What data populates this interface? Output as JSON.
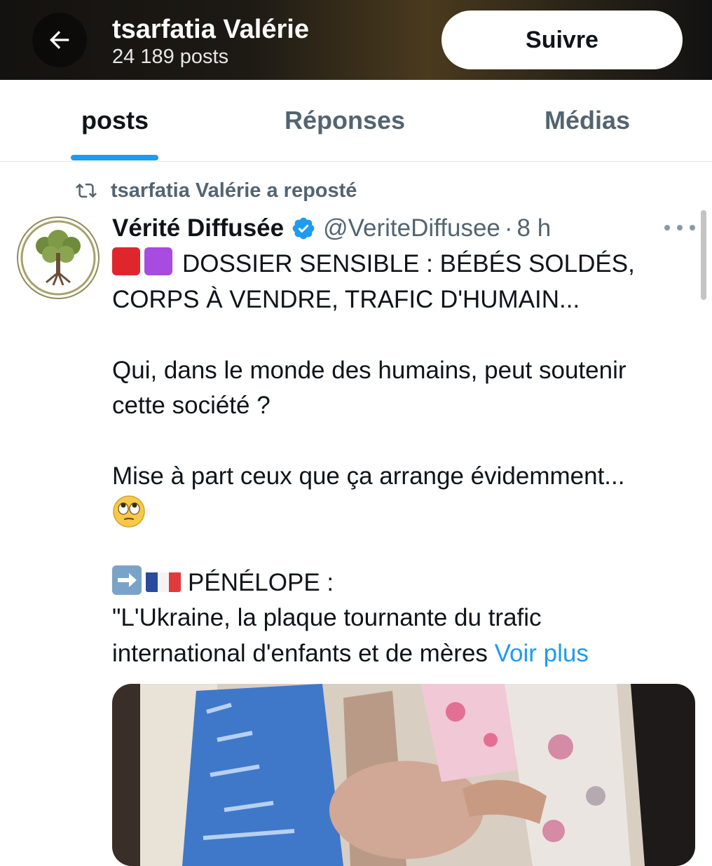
{
  "header": {
    "title": "tsarfatia Valérie",
    "post_count": "24 189 posts",
    "follow_label": "Suivre",
    "back_icon": "arrow-left-icon"
  },
  "tabs": [
    {
      "label": "posts",
      "active": true
    },
    {
      "label": "Réponses",
      "active": false
    },
    {
      "label": "Médias",
      "active": false
    }
  ],
  "repost": {
    "text": "tsarfatia Valérie a reposté",
    "icon": "repost-icon"
  },
  "post": {
    "author": "Vérité Diffusée",
    "verified": true,
    "handle": "@VeriteDiffusee",
    "separator": "·",
    "time": "8 h",
    "more_icon": "ellipsis-icon",
    "lines": {
      "l1": "DOSSIER SENSIBLE : BÉBÉS SOLDÉS,",
      "l2": "CORPS À VENDRE, TRAFIC D'HUMAIN...",
      "l3": "Qui, dans le monde des humains, peut soutenir",
      "l4": "cette société ?",
      "l5": "Mise à part ceux que ça arrange évidemment...",
      "l6": "PÉNÉLOPE :",
      "l7": "\"L'Ukraine, la plaque tournante du trafic",
      "l8": "international d'enfants et de mères"
    },
    "show_more": "Voir plus",
    "emojis": [
      "red-square",
      "purple-square",
      "face-with-rolling-eyes",
      "right-arrow",
      "france-flag"
    ]
  },
  "colors": {
    "accent": "#1d9bf0",
    "secondary_text": "#536471",
    "primary_text": "#0f1419",
    "red_square": "#e0262d",
    "purple_square": "#a84be0"
  }
}
